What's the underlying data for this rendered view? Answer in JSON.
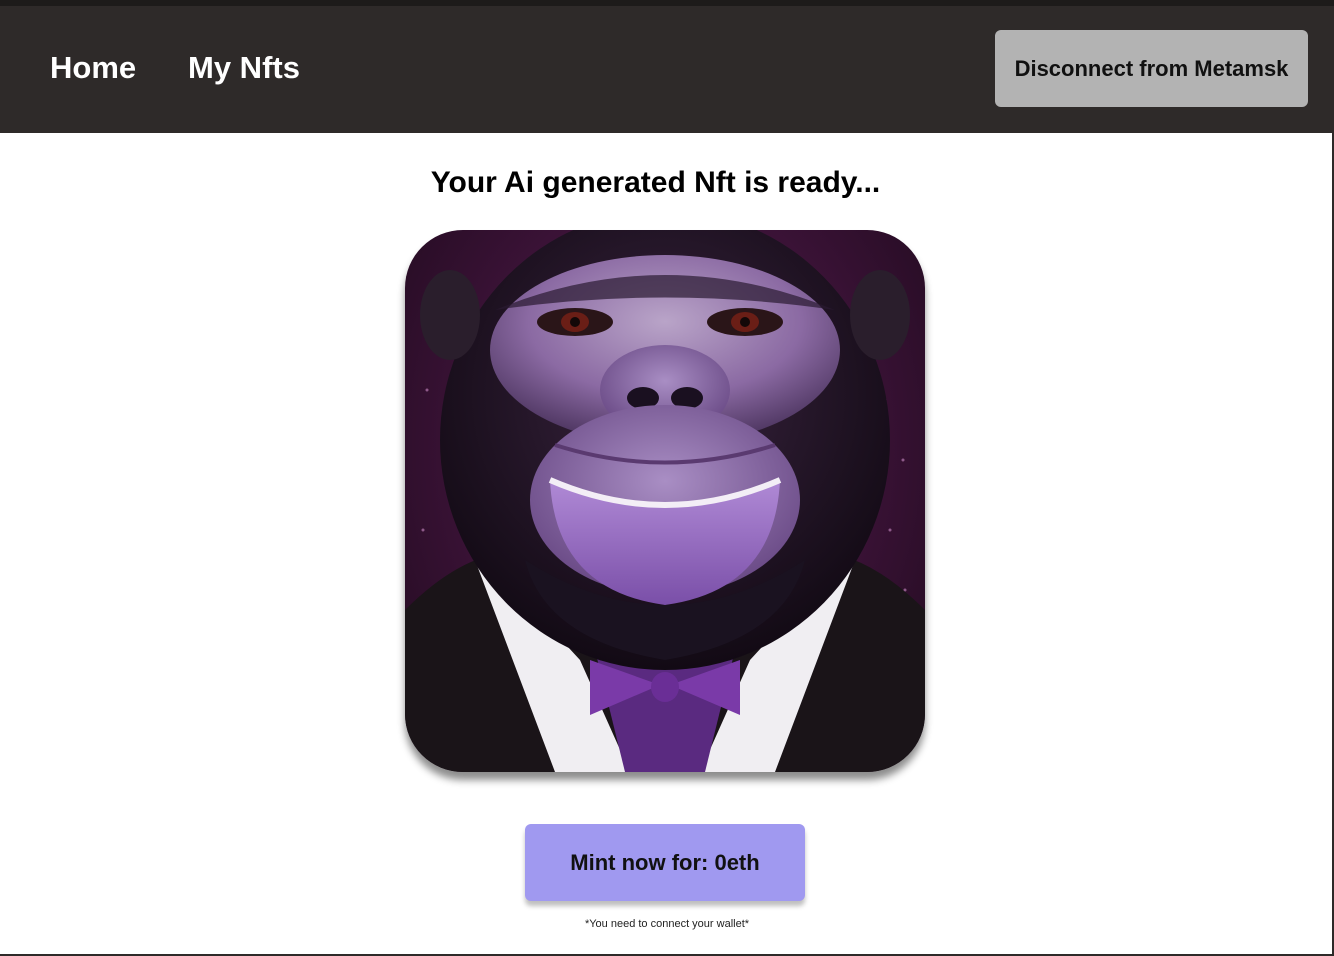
{
  "nav": {
    "home_label": "Home",
    "my_nfts_label": "My Nfts",
    "disconnect_label": "Disconnect from Metamsk"
  },
  "main": {
    "headline": "Your Ai generated Nft is ready...",
    "nft_image": "purple-gorilla-in-tuxedo-artwork",
    "mint_label": "Mint now for: 0eth",
    "wallet_note": "*You need to connect your wallet*"
  },
  "colors": {
    "navbar_bg": "#2e2a29",
    "disconnect_bg": "#b3b3b3",
    "mint_bg": "#a099f0"
  }
}
